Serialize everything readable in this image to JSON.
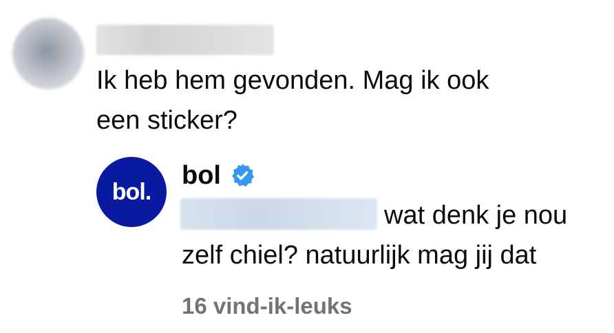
{
  "comment": {
    "text_line1": "Ik heb hem gevonden. Mag ik ook",
    "text_line2": "een sticker?"
  },
  "reply": {
    "avatar_logo_text": "bol.",
    "author": "bol",
    "verified_icon": "verified-badge-icon",
    "text_line1": "wat denk je nou",
    "text_line2": "zelf chiel? natuurlijk mag jij dat",
    "likes": "16 vind-ik-leuks"
  },
  "colors": {
    "brand": "#0a1aa0",
    "verified": "#3897f0",
    "muted": "#737373"
  }
}
